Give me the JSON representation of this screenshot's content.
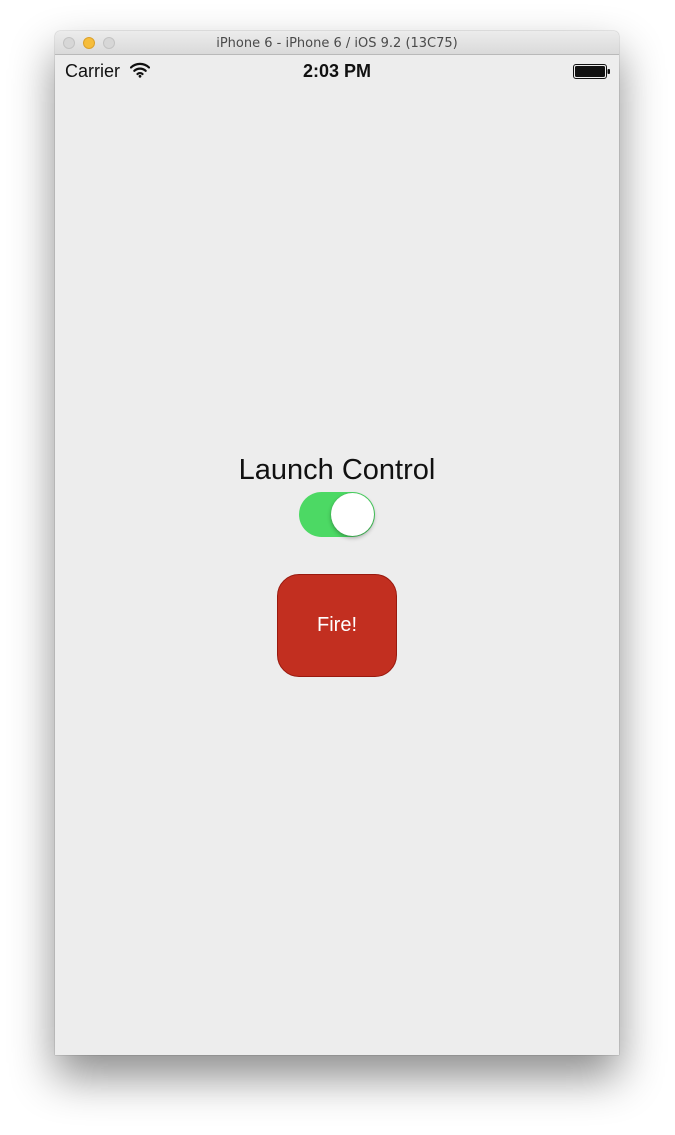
{
  "window": {
    "title": "iPhone 6 - iPhone 6 / iOS 9.2 (13C75)"
  },
  "statusbar": {
    "carrier": "Carrier",
    "time": "2:03 PM",
    "icons": [
      "wifi-icon",
      "battery-icon"
    ]
  },
  "main": {
    "heading": "Launch Control",
    "toggle": {
      "state": "on",
      "color": "#4cd964"
    },
    "fire_button": {
      "label": "Fire!",
      "color": "#c22f20"
    }
  }
}
